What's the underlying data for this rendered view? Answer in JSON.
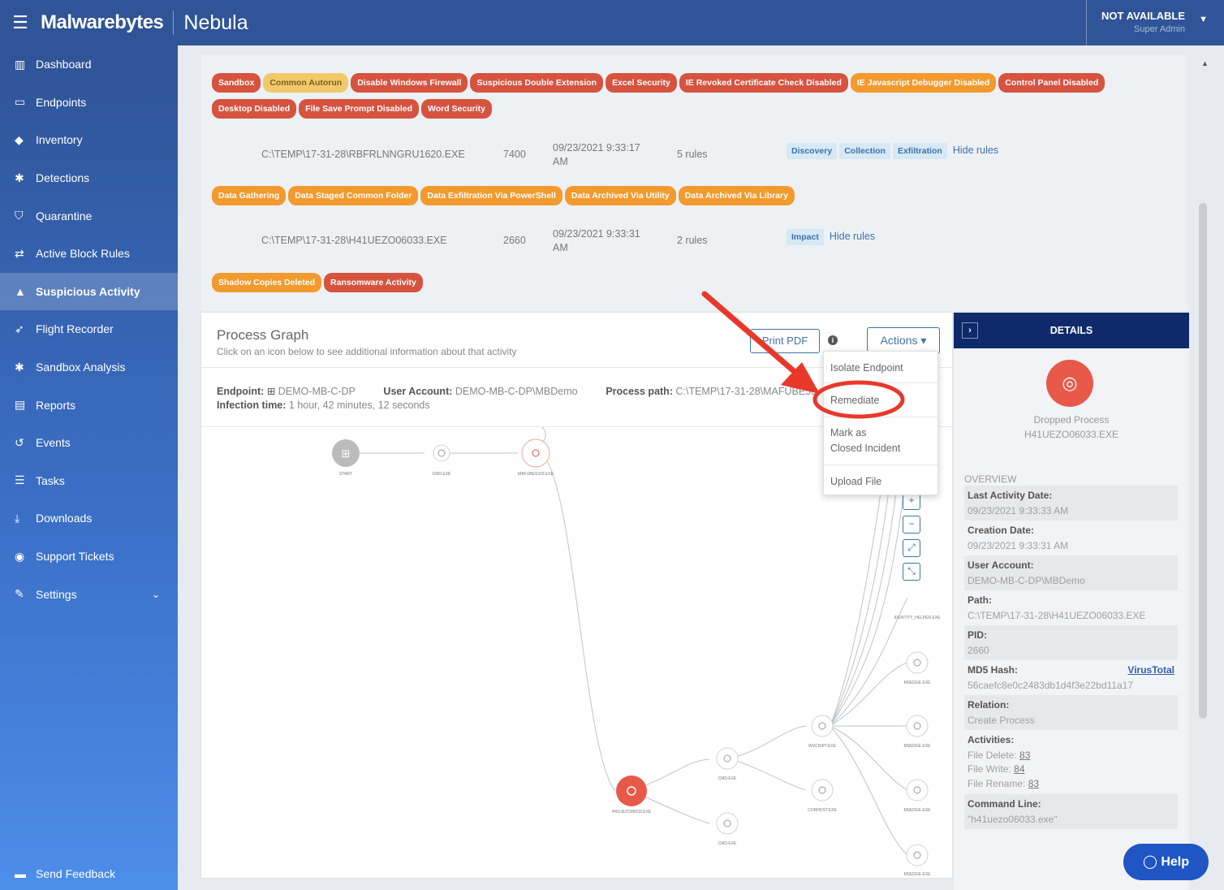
{
  "topbar": {
    "brand": "Malwarebytes",
    "product": "Nebula",
    "user_status": "NOT AVAILABLE",
    "user_role": "Super Admin"
  },
  "sidebar": {
    "items": [
      {
        "label": "Dashboard",
        "icon": "bar-chart-icon",
        "glyph": "▥"
      },
      {
        "label": "Endpoints",
        "icon": "monitor-icon",
        "glyph": "▭"
      },
      {
        "label": "Inventory",
        "icon": "tag-icon",
        "glyph": "◆"
      },
      {
        "label": "Detections",
        "icon": "bug-icon",
        "glyph": "✱"
      },
      {
        "label": "Quarantine",
        "icon": "shield-icon",
        "glyph": "⛉"
      },
      {
        "label": "Active Block Rules",
        "icon": "arrows-icon",
        "glyph": "⇄"
      },
      {
        "label": "Suspicious Activity",
        "icon": "lock-icon",
        "glyph": "▲"
      },
      {
        "label": "Flight Recorder",
        "icon": "paper-plane-icon",
        "glyph": "➶"
      },
      {
        "label": "Sandbox Analysis",
        "icon": "bug-icon",
        "glyph": "✱"
      },
      {
        "label": "Reports",
        "icon": "document-icon",
        "glyph": "▤"
      },
      {
        "label": "Events",
        "icon": "history-icon",
        "glyph": "↺"
      },
      {
        "label": "Tasks",
        "icon": "list-icon",
        "glyph": "☰"
      },
      {
        "label": "Downloads",
        "icon": "download-icon",
        "glyph": "⤓"
      },
      {
        "label": "Support Tickets",
        "icon": "chat-icon",
        "glyph": "◉"
      },
      {
        "label": "Settings",
        "icon": "wrench-icon",
        "glyph": "✎"
      }
    ],
    "feedback": "Send Feedback"
  },
  "tags": {
    "row1": [
      {
        "label": "Sandbox",
        "color": "red"
      },
      {
        "label": "Common Autorun",
        "color": "yellow"
      },
      {
        "label": "Disable Windows Firewall",
        "color": "red"
      },
      {
        "label": "Suspicious Double Extension",
        "color": "red"
      },
      {
        "label": "Excel Security",
        "color": "red"
      },
      {
        "label": "IE Revoked Certificate Check Disabled",
        "color": "red"
      },
      {
        "label": "IE Javascript Debugger Disabled",
        "color": "orange"
      },
      {
        "label": "Control Panel Disabled",
        "color": "red"
      }
    ],
    "row2": [
      {
        "label": "Desktop Disabled",
        "color": "red"
      },
      {
        "label": "File Save Prompt Disabled",
        "color": "red"
      },
      {
        "label": "Word Security",
        "color": "red"
      }
    ],
    "row3": [
      {
        "label": "Data Gathering",
        "color": "orange"
      },
      {
        "label": "Data Staged Common Folder",
        "color": "orange"
      },
      {
        "label": "Data Exfiltration Via PowerShell",
        "color": "orange"
      },
      {
        "label": "Data Archived Via Utility",
        "color": "orange"
      },
      {
        "label": "Data Archived Via Library",
        "color": "orange"
      }
    ],
    "row4": [
      {
        "label": "Shadow Copies Deleted",
        "color": "orange"
      },
      {
        "label": "Ransomware Activity",
        "color": "red"
      }
    ]
  },
  "processes": [
    {
      "path": "C:\\TEMP\\17-31-28\\RBFRLNNGRU1620.EXE",
      "pid": "7400",
      "date1": "09/23/2021 9:33:17",
      "date2": "AM",
      "rules": "5 rules",
      "mitre": [
        "Discovery",
        "Collection",
        "Exfiltration"
      ],
      "hide": "Hide rules"
    },
    {
      "path": "C:\\TEMP\\17-31-28\\H41UEZO06033.EXE",
      "pid": "2660",
      "date1": "09/23/2021 9:33:31",
      "date2": "AM",
      "rules": "2 rules",
      "mitre": [
        "Impact"
      ],
      "hide": "Hide rules"
    }
  ],
  "graph": {
    "title": "Process Graph",
    "subtitle": "Click on an icon below to see additional information about that activity",
    "pdf_label": "Print PDF",
    "actions_label": "Actions ▾",
    "endpoint_label": "Endpoint:",
    "endpoint_value": "DEMO-MB-C-DP",
    "account_label": "User Account:",
    "account_value": "DEMO-MB-C-DP\\MBDemo",
    "path_label": "Process path:",
    "path_value": "C:\\TEMP\\17-31-28\\MAFUBE53",
    "infection_label": "Infection time:",
    "infection_value": "1 hour, 42 minutes, 12 seconds",
    "nodes": {
      "start": "START",
      "cmd1": "CMD.EXE",
      "mafube": "MAFUBES329.EXE",
      "h41": "H41UEZO06033.EXE",
      "cmd2": "CMD.EXE",
      "cmd3": "CMD.EXE",
      "wscript": "WSCRIPT.EXE",
      "conhost": "CONHOST.EXE",
      "identity": "IDENTITY_HELPER.EXE",
      "msedge1": "MSEDGE.EXE",
      "msedge2": "MSEDGE.EXE",
      "msedge3": "MSEDGE.EXE",
      "msedge4": "MSEDGE.EXE"
    }
  },
  "actions_menu": {
    "isolate": "Isolate Endpoint",
    "remediate": "Remediate",
    "mark1": "Mark as",
    "mark2": "Closed Incident",
    "upload": "Upload File"
  },
  "details": {
    "header": "DETAILS",
    "type": "Dropped Process",
    "name": "H41UEZO06033.EXE",
    "overview": "OVERVIEW",
    "last_activity_label": "Last Activity Date:",
    "last_activity_value": "09/23/2021 9:33:33 AM",
    "creation_label": "Creation Date:",
    "creation_value": "09/23/2021 9:33:31 AM",
    "account_label": "User Account:",
    "account_value": "DEMO-MB-C-DP\\MBDemo",
    "path_label": "Path:",
    "path_value": "C:\\TEMP\\17-31-28\\H41UEZO06033.EXE",
    "pid_label": "PID:",
    "pid_value": "2660",
    "md5_label": "MD5 Hash:",
    "md5_link": "VirusTotal",
    "md5_value": "56caefc8e0c2483db1d4f3e22bd11a17",
    "relation_label": "Relation:",
    "relation_value": "Create Process",
    "activities_label": "Activities:",
    "file_delete_label": "File Delete:",
    "file_delete_value": "83",
    "file_write_label": "File Write:",
    "file_write_value": "84",
    "file_rename_label": "File Rename:",
    "file_rename_value": "83",
    "cmd_label": "Command Line:",
    "cmd_value": "\"h41uezo06033.exe\""
  },
  "help": "Help",
  "colors": {
    "brand_blue": "#2f5497",
    "details_header": "#0f2a6b",
    "tag_red": "#d6533f",
    "tag_orange": "#f29a2e",
    "annotation_red": "#e8382a",
    "help_blue": "#1f55c5"
  }
}
